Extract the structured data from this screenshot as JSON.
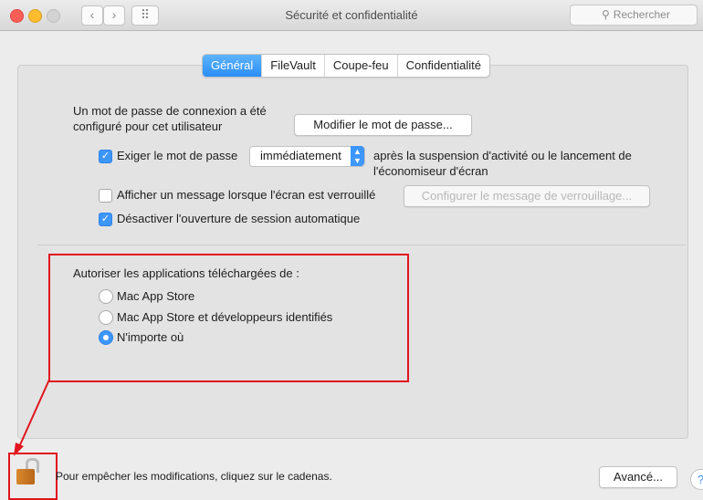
{
  "window": {
    "title": "Sécurité et confidentialité",
    "search_placeholder": "Rechercher",
    "grid_label": "⠿"
  },
  "tabs": [
    {
      "label": "Général",
      "active": true
    },
    {
      "label": "FileVault",
      "active": false
    },
    {
      "label": "Coupe-feu",
      "active": false
    },
    {
      "label": "Confidentialité",
      "active": false
    }
  ],
  "general": {
    "password_set_line1": "Un mot de passe de connexion a été",
    "password_set_line2": "configuré pour cet utilisateur",
    "change_password_button": "Modifier le mot de passe...",
    "require_password": {
      "checked": true,
      "label": "Exiger le mot de passe",
      "select_value": "immédiatement",
      "suffix_line1": "après la suspension d'activité ou le lancement de",
      "suffix_line2": "l'économiseur d'écran"
    },
    "show_message": {
      "checked": false,
      "label": "Afficher un message lorsque l'écran est verrouillé",
      "button": "Configurer le message de verrouillage..."
    },
    "disable_autologin": {
      "checked": true,
      "label": "Désactiver l'ouverture de session automatique"
    }
  },
  "apps": {
    "heading": "Autoriser les applications téléchargées de :",
    "options": [
      {
        "label": "Mac App Store",
        "selected": false
      },
      {
        "label": "Mac App Store et développeurs identifiés",
        "selected": false
      },
      {
        "label": "N'importe où",
        "selected": true
      }
    ]
  },
  "footer": {
    "lock_text": "Pour empêcher les modifications, cliquez sur le cadenas.",
    "advanced_button": "Avancé...",
    "help_label": "?"
  },
  "icons": {
    "back": "chevron-left-icon",
    "forward": "chevron-right-icon",
    "grid": "grid-icon",
    "search": "search-icon",
    "lock": "lock-icon",
    "check": "checkmark-icon"
  },
  "colors": {
    "accent": "#3d96fa",
    "annotation": "#e1141e",
    "window_bg": "#ececec"
  }
}
